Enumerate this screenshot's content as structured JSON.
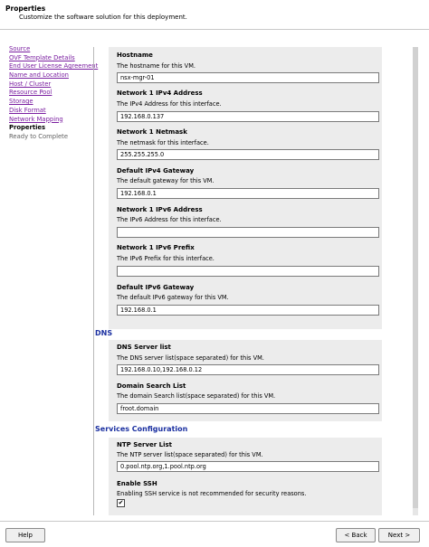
{
  "header": {
    "title": "Properties",
    "subtitle": "Customize the software solution for this deployment."
  },
  "nav": [
    {
      "label": "Source",
      "state": "link"
    },
    {
      "label": "OVF Template Details",
      "state": "link"
    },
    {
      "label": "End User License Agreement",
      "state": "link"
    },
    {
      "label": "Name and Location",
      "state": "link"
    },
    {
      "label": "Host / Cluster",
      "state": "link"
    },
    {
      "label": "Resource Pool",
      "state": "link"
    },
    {
      "label": "Storage",
      "state": "link"
    },
    {
      "label": "Disk Format",
      "state": "link"
    },
    {
      "label": "Network Mapping",
      "state": "link"
    },
    {
      "label": "Properties",
      "state": "current"
    },
    {
      "label": "Ready to Complete",
      "state": "pending"
    }
  ],
  "fields": {
    "hostname": {
      "title": "Hostname",
      "desc": "The hostname for this VM.",
      "value": "nsx-mgr-01"
    },
    "ipv4_address": {
      "title": "Network 1 IPv4 Address",
      "desc": "The IPv4 Address for this interface.",
      "value": "192.168.0.137"
    },
    "netmask": {
      "title": "Network 1 Netmask",
      "desc": "The netmask for this interface.",
      "value": "255.255.255.0"
    },
    "ipv4_gateway": {
      "title": "Default IPv4 Gateway",
      "desc": "The default gateway for this VM.",
      "value": "192.168.0.1"
    },
    "ipv6_address": {
      "title": "Network 1 IPv6 Address",
      "desc": "The IPv6 Address for this interface.",
      "value": ""
    },
    "ipv6_prefix": {
      "title": "Network 1 IPv6 Prefix",
      "desc": "The IPv6 Prefix for this interface.",
      "value": ""
    },
    "ipv6_gateway": {
      "title": "Default IPv6 Gateway",
      "desc": "The default IPv6 gateway for this VM.",
      "value": "192.168.0.1"
    }
  },
  "dns": {
    "header": "DNS",
    "server_list": {
      "title": "DNS Server list",
      "desc": "The DNS server list(space separated) for this VM.",
      "value": "192.168.0.10,192.168.0.12"
    },
    "search_list": {
      "title": "Domain Search List",
      "desc": "The domain Search list(space separated) for this VM.",
      "value": "froot.domain"
    }
  },
  "services": {
    "header": "Services Configuration",
    "ntp": {
      "title": "NTP Server List",
      "desc": "The NTP server list(space separated) for this VM.",
      "value": "0.pool.ntp.org,1.pool.ntp.org"
    },
    "ssh": {
      "title": "Enable SSH",
      "desc": "Enabling SSH service is not recommended for security reasons.",
      "mark": "✔"
    }
  },
  "footer": {
    "help": "Help",
    "back": "< Back",
    "next": "Next >"
  }
}
